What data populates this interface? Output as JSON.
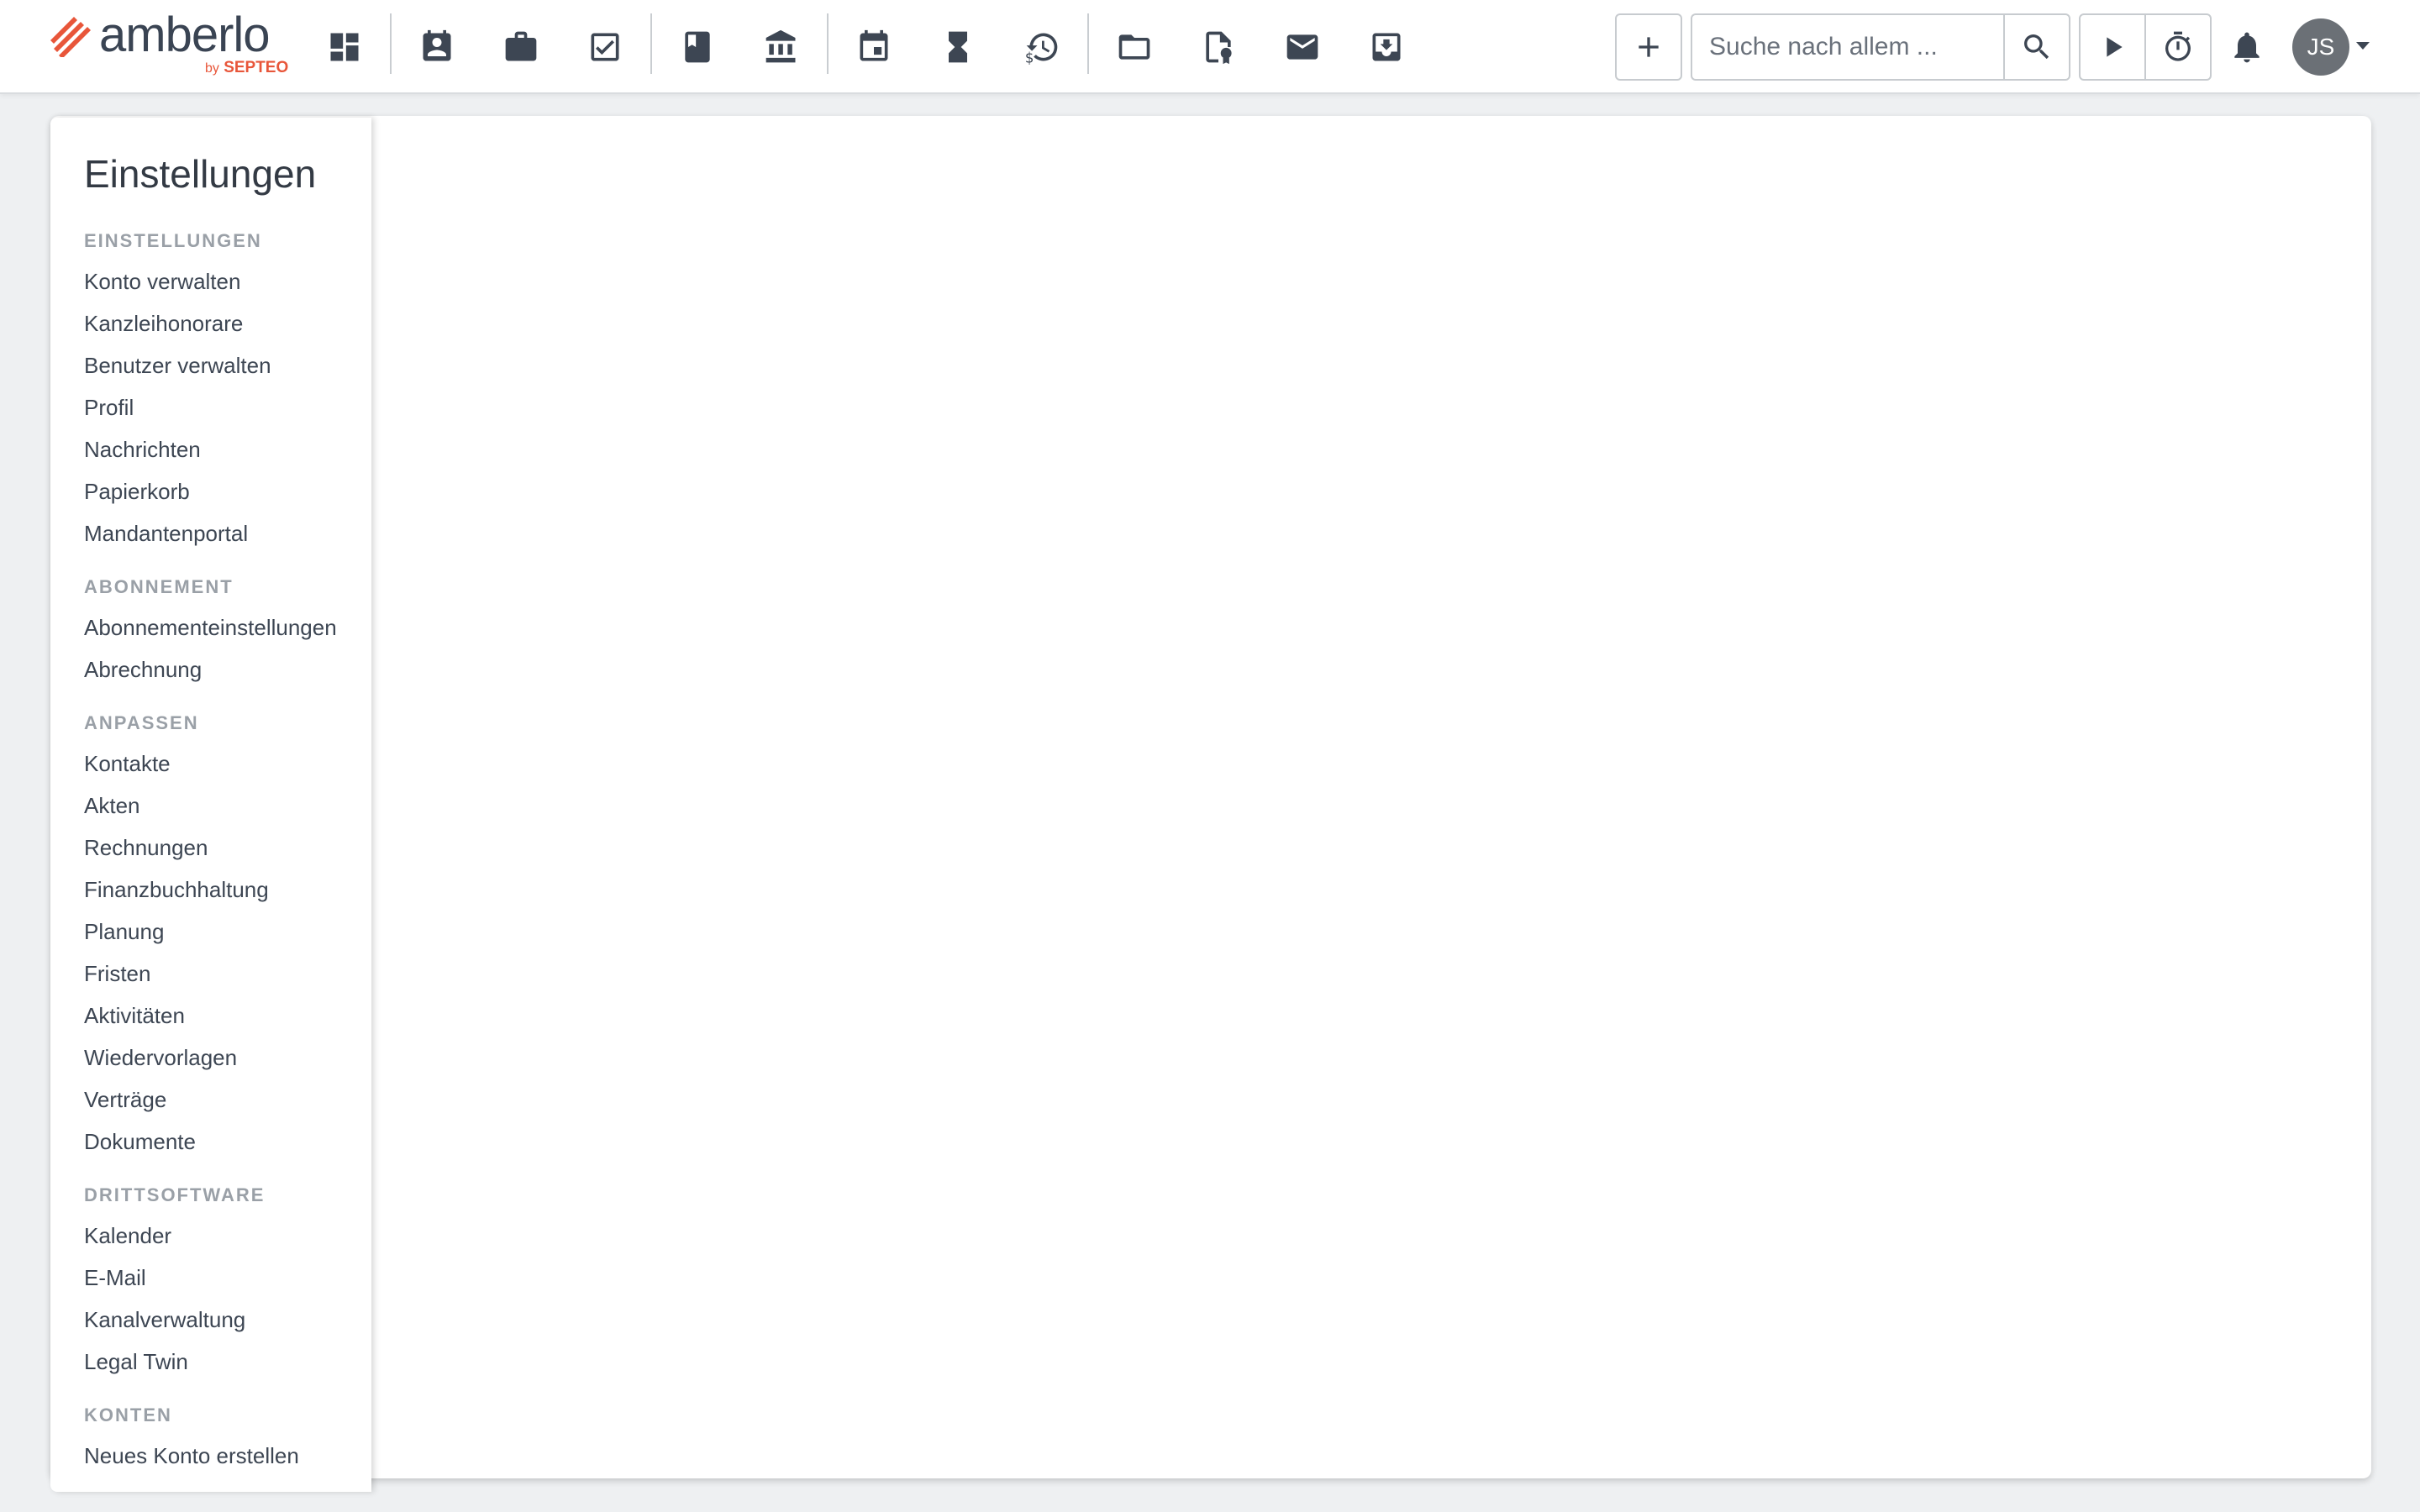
{
  "app": {
    "logo_text": "amberlo",
    "logo_by": "by",
    "logo_brand": "SEPTEO",
    "brand_color": "#e8563a"
  },
  "toolbar": {
    "nav_icons": [
      "dashboard-icon",
      "contacts-icon",
      "matters-icon",
      "tasks-icon",
      "notebook-icon",
      "bank-icon",
      "calendar-icon",
      "hourglass-icon",
      "billing-history-icon",
      "folder-icon",
      "document-certificate-icon",
      "mail-icon",
      "inbox-download-icon"
    ],
    "add_icon": "plus-icon",
    "search_placeholder": "Suche nach allem ...",
    "search_icon": "search-icon",
    "play_icon": "play-icon",
    "timer_icon": "stopwatch-icon",
    "bell_icon": "bell-icon",
    "avatar_initials": "JS"
  },
  "sidebar": {
    "title": "Einstellungen",
    "sections": [
      {
        "heading": "EINSTELLUNGEN",
        "items": [
          "Konto verwalten",
          "Kanzleihonorare",
          "Benutzer verwalten",
          "Profil",
          "Nachrichten",
          "Papierkorb",
          "Mandantenportal"
        ]
      },
      {
        "heading": "ABONNEMENT",
        "items": [
          "Abonnementeinstellungen",
          "Abrechnung"
        ]
      },
      {
        "heading": "ANPASSEN",
        "items": [
          "Kontakte",
          "Akten",
          "Rechnungen",
          "Finanzbuchhaltung",
          "Planung",
          "Fristen",
          "Aktivitäten",
          "Wiedervorlagen",
          "Verträge",
          "Dokumente"
        ]
      },
      {
        "heading": "DRITTSOFTWARE",
        "items": [
          "Kalender",
          "E-Mail",
          "Kanalverwaltung",
          "Legal Twin"
        ]
      },
      {
        "heading": "KONTEN",
        "items": [
          "Neues Konto erstellen"
        ]
      }
    ]
  }
}
